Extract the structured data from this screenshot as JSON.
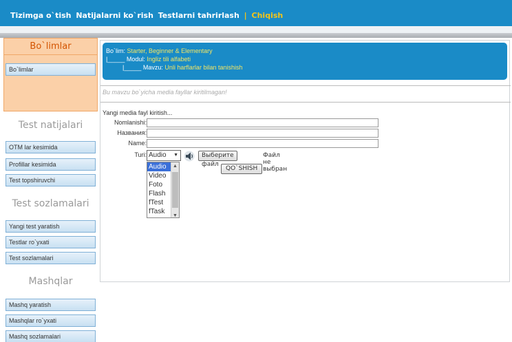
{
  "nav": {
    "items": [
      "Tizimga o`tish",
      "Natijalarni ko`rish",
      "Testlarni tahrirlash"
    ],
    "separator": "|",
    "exit": "Chiqish"
  },
  "sidebar": {
    "section1_title": "Bo`limlar",
    "section1_items": [
      "Bo`limlar"
    ],
    "section2_title": "Test natijalari",
    "section2_items": [
      "OTM lar kesimida",
      "Profillar kesimida",
      "Test topshiruvchi"
    ],
    "section3_title": "Test sozlamalari",
    "section3_items": [
      "Yangi test yaratish",
      "Testlar ro`yxati",
      "Test sozlamalari"
    ],
    "section4_title": "Mashqlar",
    "section4_items": [
      "Mashq yaratish",
      "Mashqlar ro`yxati",
      "Mashq sozlamalari"
    ]
  },
  "breadcrumb": {
    "section_label": "Bo`lim:",
    "section_value": "Starter, Beginner & Elementary",
    "module_prefix": "|_____",
    "module_label": "Modul:",
    "module_value": "Ingliz tili alfabeti",
    "topic_prefix": "|_____",
    "topic_label": "Mavzu:",
    "topic_value": "Unli harflarlar bilan tanishish"
  },
  "no_media_text": "Bu mavzu bo`yicha media fayllar kiritilmagan!",
  "form": {
    "heading": "Yangi media fayl kiritish...",
    "name_uz_label": "Nomlanishi:",
    "name_ru_label": "Названия:",
    "name_en_label": "Name:",
    "type_label": "Turi:",
    "type_selected": "Audio",
    "type_options": [
      "Audio",
      "Video",
      "Foto",
      "Flash",
      "fTest",
      "fTask"
    ],
    "file_button": "Выберите файл",
    "file_status": "Файл не выбран",
    "submit_button": "QO`SHISH"
  }
}
